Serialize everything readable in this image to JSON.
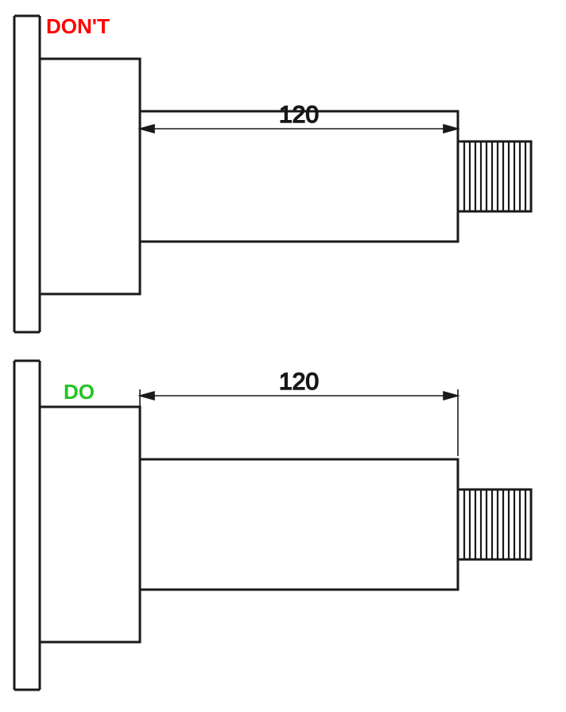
{
  "figure": {
    "dont_label": "DON'T",
    "do_label": "DO",
    "dimension_top": "120",
    "dimension_bottom": "120"
  },
  "drawing": {
    "stroke_main": "#1a1a1a",
    "stroke_thin": "#1a1a1a",
    "thread_lines": 12
  }
}
